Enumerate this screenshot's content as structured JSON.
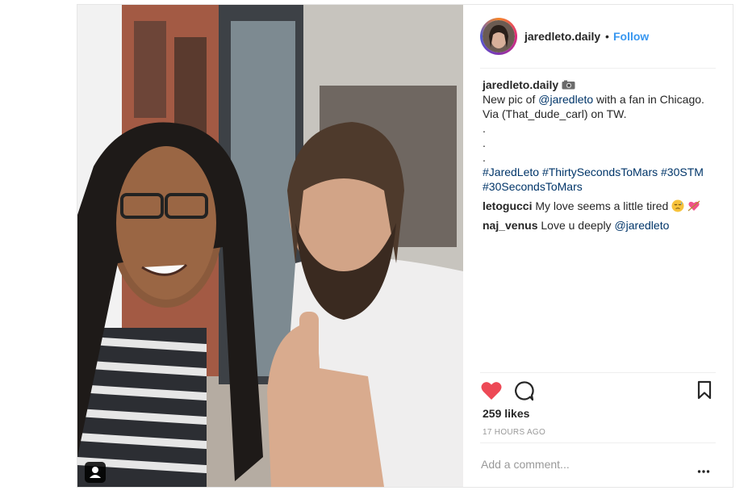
{
  "post": {
    "username": "jaredleto.daily",
    "separator": "•",
    "follow_label": "Follow",
    "caption": {
      "user": "jaredleto.daily",
      "icon": "camera-emoji",
      "line1_pre": "New pic of ",
      "line1_mention": "@jaredleto",
      "line1_post": " with a fan in Chicago.",
      "line2": "Via (That_dude_carl) on TW.",
      "dots": [
        ".",
        ".",
        "."
      ],
      "hashtag1": "#JaredLeto",
      "hashtag2": "#ThirtySecondsToMars",
      "hashtag3": "#30STM",
      "hashtag4": "#30SecondsToMars"
    },
    "comments": [
      {
        "user": "letogucci",
        "text": "My love seems a little tired",
        "emojis": [
          "downcast-face-emoji",
          "heart-arrow-emoji"
        ]
      },
      {
        "user": "naj_venus",
        "text_pre": "Love u deeply ",
        "mention": "@jaredleto"
      }
    ],
    "likes": "259 likes",
    "timestamp": "17 HOURS AGO",
    "comment_placeholder": "Add a comment...",
    "colors": {
      "heart": "#ed4956",
      "link": "#3897f0",
      "hashtag": "#003569",
      "text": "#262626",
      "muted": "#999999"
    },
    "icons": [
      "user-tag-icon",
      "heart-icon",
      "comment-icon",
      "bookmark-icon",
      "more-options-icon"
    ]
  }
}
